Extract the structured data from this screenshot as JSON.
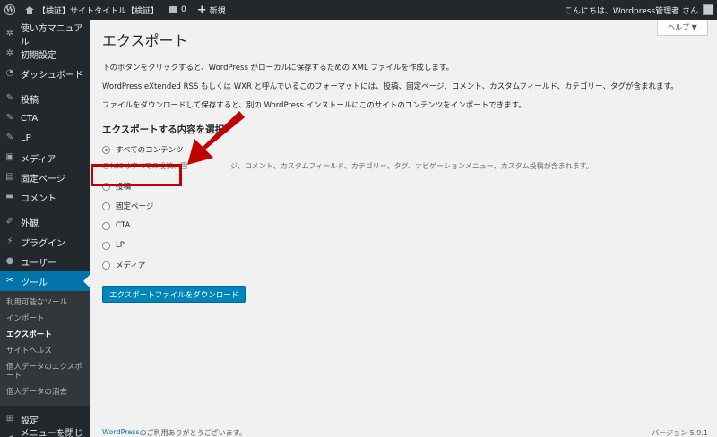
{
  "adminbar": {
    "site_title": "【検証】サイトタイトル【検証】",
    "comment_count": "0",
    "new_label": "新規",
    "greeting": "こんにちは、Wordpress管理者 さん"
  },
  "sidebar": {
    "items": [
      {
        "label": "使い方マニュアル",
        "icon": "gear-icon"
      },
      {
        "label": "初期設定",
        "icon": "gear-icon"
      },
      {
        "label": "ダッシュボード",
        "icon": "dashboard-icon"
      },
      {
        "label": "投稿",
        "icon": "pin-icon"
      },
      {
        "label": "CTA",
        "icon": "pin-icon"
      },
      {
        "label": "LP",
        "icon": "pin-icon"
      },
      {
        "label": "メディア",
        "icon": "media-icon"
      },
      {
        "label": "固定ページ",
        "icon": "page-icon"
      },
      {
        "label": "コメント",
        "icon": "comment-icon"
      },
      {
        "label": "外観",
        "icon": "brush-icon"
      },
      {
        "label": "プラグイン",
        "icon": "plugin-icon"
      },
      {
        "label": "ユーザー",
        "icon": "user-icon"
      },
      {
        "label": "ツール",
        "icon": "wrench-icon"
      },
      {
        "label": "設定",
        "icon": "settings-icon"
      },
      {
        "label": "メニューを閉じる",
        "icon": "collapse-icon"
      }
    ],
    "submenu": [
      "利用可能なツール",
      "インポート",
      "エクスポート",
      "サイトヘルス",
      "個人データのエクスポート",
      "個人データの消去"
    ]
  },
  "help_label": "ヘルプ ▼",
  "main": {
    "title": "エクスポート",
    "para1": "下のボタンをクリックすると、WordPress がローカルに保存するための XML ファイルを作成します。",
    "para2": "WordPress eXtended RSS もしくは WXR と呼んでいるこのフォーマットには、投稿、固定ページ、コメント、カスタムフィールド、カテゴリー、タグが含まれます。",
    "para3": "ファイルをダウンロードして保存すると、別の WordPress インストールにこのサイトのコンテンツをインポートできます。",
    "section_title": "エクスポートする内容を選択",
    "all_content": "すべてのコンテンツ",
    "all_desc": "これにはすべての投稿、固",
    "all_desc_rest": "ジ、コメント、カスタムフィールド、カテゴリー、タグ、ナビゲーションメニュー、カスタム投稿が含まれます。",
    "options": [
      "投稿",
      "固定ページ",
      "CTA",
      "LP",
      "メディア"
    ],
    "download_button": "エクスポートファイルをダウンロード"
  },
  "footer": {
    "link": "WordPress",
    "thanks": " のご利用ありがとうございます。",
    "version": "バージョン 5.9.1"
  }
}
